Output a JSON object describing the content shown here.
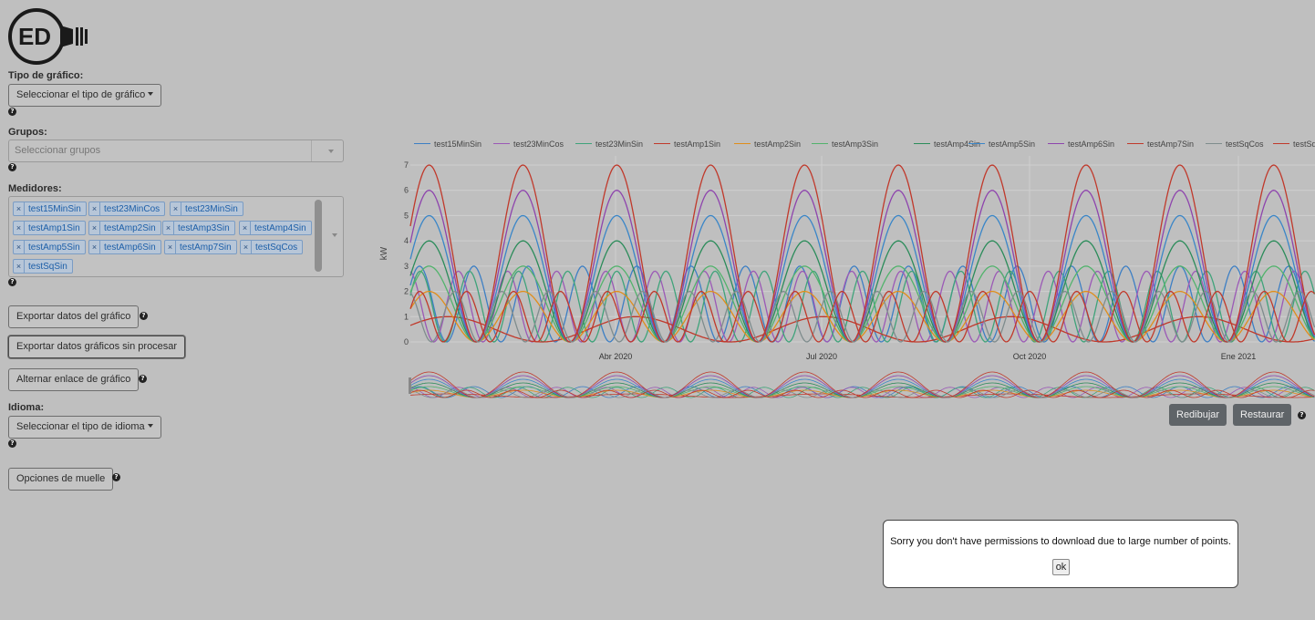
{
  "sidebar": {
    "chart_type_label": "Tipo de gráfico:",
    "chart_type_button": "Seleccionar el tipo de gráfico",
    "groups_label": "Grupos:",
    "groups_placeholder": "Seleccionar grupos",
    "meters_label": "Medidores:",
    "meters": [
      "test15MinSin",
      "test23MinCos",
      "test23MinSin",
      "testAmp1Sin",
      "testAmp2Sin",
      "testAmp3Sin",
      "testAmp4Sin",
      "testAmp5Sin",
      "testAmp6Sin",
      "testAmp7Sin",
      "testSqCos",
      "testSqSin"
    ],
    "export_chart_button": "Exportar datos del gráfico",
    "export_raw_button": "Exportar datos gráficos sin procesar",
    "toggle_link_button": "Alternar enlace de gráfico",
    "language_label": "Idioma:",
    "language_button": "Seleccionar el tipo de idioma",
    "dock_options_button": "Opciones de muelle",
    "tag_remove_glyph": "×",
    "help_glyph": "?"
  },
  "logo": {
    "text": "ED"
  },
  "chart_controls": {
    "redraw_button": "Redibujar",
    "reset_button": "Restaurar"
  },
  "dialog": {
    "message": "Sorry you don't have permissions to download due to large number of points.",
    "ok_button": "ok"
  },
  "chart_data": {
    "type": "line",
    "ylabel": "kW",
    "ylim": [
      0,
      7
    ],
    "yticks": [
      0,
      1,
      2,
      3,
      4,
      5,
      6,
      7
    ],
    "xticks": [
      "Abr 2020",
      "Jul 2020",
      "Oct 2020",
      "Ene 2021"
    ],
    "grid": true,
    "legend_position": "top",
    "cycles_visible": 11,
    "series": [
      {
        "name": "test15MinSin",
        "color": "#3d7fc4",
        "amplitude": 1.5,
        "offset": 1.5,
        "cycles": 19,
        "phase": 0.2
      },
      {
        "name": "test23MinCos",
        "color": "#9b59b6",
        "amplitude": 1.4,
        "offset": 1.4,
        "cycles": 21,
        "phase": 1.4
      },
      {
        "name": "test23MinSin",
        "color": "#3fa37a",
        "amplitude": 1.4,
        "offset": 1.4,
        "cycles": 21,
        "phase": 0.0
      },
      {
        "name": "testAmp1Sin",
        "color": "#c0392b",
        "amplitude": 0.5,
        "offset": 0.5,
        "cycles": 5.5,
        "phase": 0.0
      },
      {
        "name": "testAmp2Sin",
        "color": "#e08e1b",
        "amplitude": 1.0,
        "offset": 1.0,
        "cycles": 11,
        "phase": 0.0
      },
      {
        "name": "testAmp3Sin",
        "color": "#52b36c",
        "amplitude": 1.5,
        "offset": 1.5,
        "cycles": 11,
        "phase": 0.0
      },
      {
        "name": "testAmp4Sin",
        "color": "#2b8c5a",
        "amplitude": 2.0,
        "offset": 2.0,
        "cycles": 11,
        "phase": 0.0
      },
      {
        "name": "testAmp5Sin",
        "color": "#3a86c8",
        "amplitude": 2.5,
        "offset": 2.5,
        "cycles": 11,
        "phase": 0.0
      },
      {
        "name": "testAmp6Sin",
        "color": "#8e44ad",
        "amplitude": 3.0,
        "offset": 3.0,
        "cycles": 11,
        "phase": 0.0
      },
      {
        "name": "testAmp7Sin",
        "color": "#c0392b",
        "amplitude": 3.5,
        "offset": 3.5,
        "cycles": 11,
        "phase": 0.0
      },
      {
        "name": "testSqCos",
        "color": "#7f8c8d",
        "amplitude": 1.0,
        "offset": 1.0,
        "cycles": 22,
        "phase": 1.57
      },
      {
        "name": "testSqSin",
        "color": "#c0392b",
        "amplitude": 1.0,
        "offset": 1.0,
        "cycles": 22,
        "phase": 0.0
      }
    ]
  }
}
